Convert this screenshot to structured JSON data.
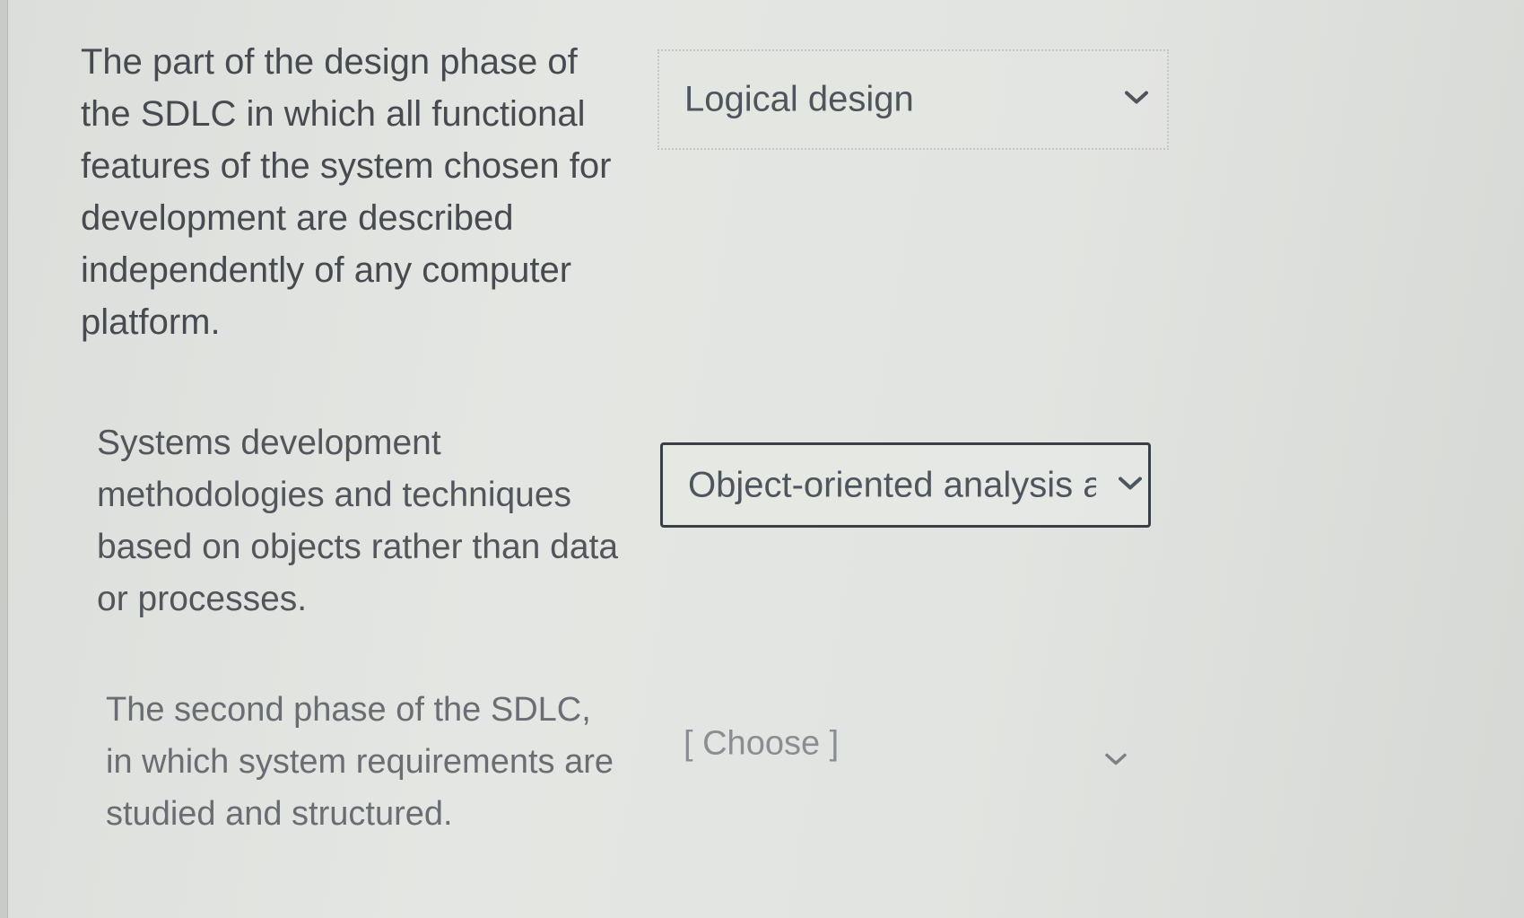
{
  "questions": [
    {
      "prompt": "The part of the design phase of\nthe SDLC in which all functional\nfeatures of the system chosen for\ndevelopment are described\nindependently of any computer\nplatform.",
      "selected": "Logical design",
      "icon": "chevron-down-icon",
      "state": "answered"
    },
    {
      "prompt": "Systems development\nmethodologies and techniques\nbased on objects rather than data\nor processes.",
      "selected": "Object-oriented analysis a",
      "icon": "chevron-down-icon",
      "state": "focused"
    },
    {
      "prompt": "The second phase of the SDLC,\nin which system requirements are\nstudied and structured.",
      "selected": "[ Choose ]",
      "icon": "chevron-down-icon",
      "state": "empty"
    }
  ],
  "colors": {
    "prompt_text": "#4a4d52",
    "select_text": "#4f555c",
    "focused_border": "#3a3f44",
    "dotted_border": "#c4c7c4",
    "placeholder_text": "#8a8e92"
  }
}
